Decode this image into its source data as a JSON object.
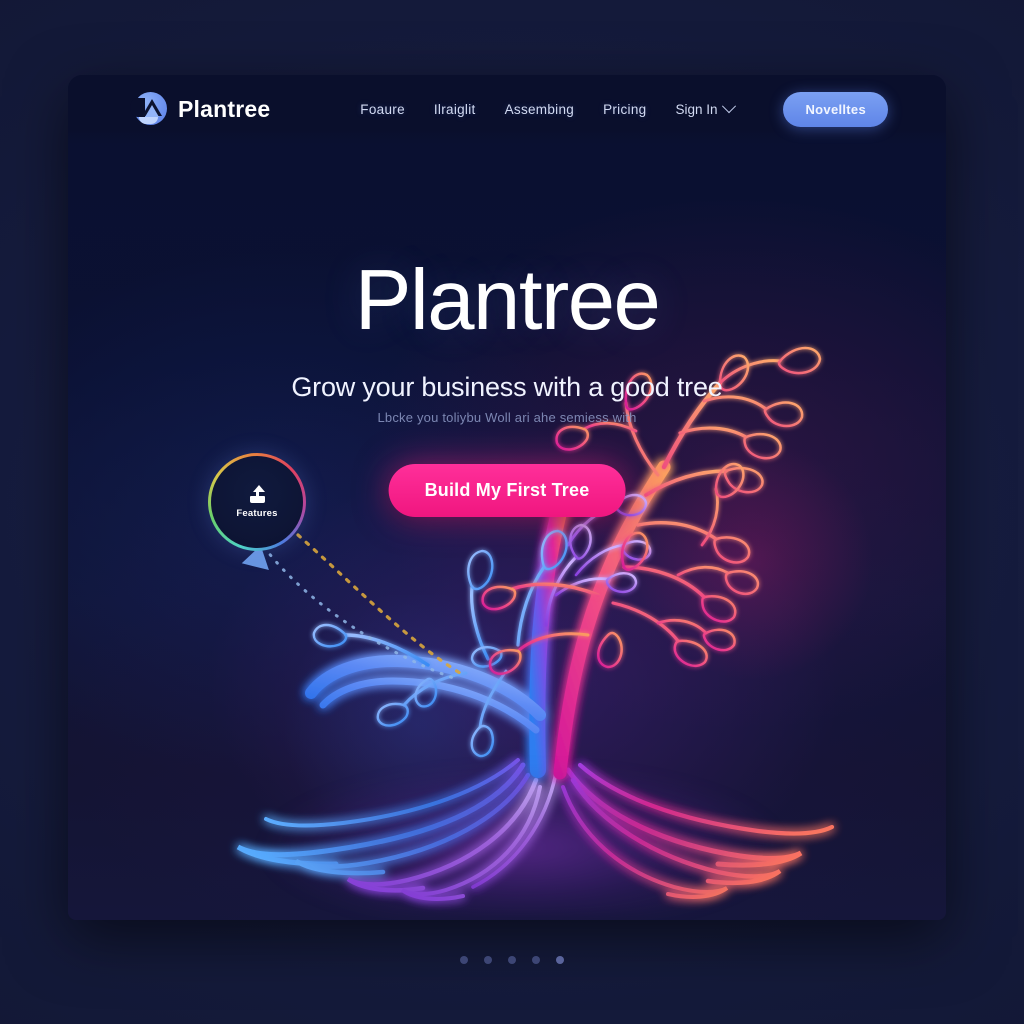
{
  "brand": {
    "name": "Plantree",
    "logo_icon": "plantree-leaf-logo"
  },
  "nav": {
    "links": [
      {
        "label": "Foaure",
        "name": "feature"
      },
      {
        "label": "Ilraiglit",
        "name": "insight"
      },
      {
        "label": "Assembing",
        "name": "assembling"
      },
      {
        "label": "Pricing",
        "name": "pricing"
      }
    ],
    "signin": {
      "label": "Sign In",
      "chevron": "chevron-down-icon"
    },
    "cta": {
      "label": "Novelltes"
    }
  },
  "hero": {
    "title": "Plantree",
    "subtitle": "Grow your business with a good tree",
    "tagline": "Lbcke you toliybu Woll ari ahe semiess with",
    "cta_label": "Build My First Tree"
  },
  "badge": {
    "label": "Features",
    "icon": "upload-icon"
  },
  "carousel": {
    "dots": 5,
    "active_index": 4
  },
  "colors": {
    "page_background": "#161c3d",
    "card_background": "#0d1330",
    "nav_background": "#0a0f2c",
    "accent_pink": "#ff2f9a",
    "accent_blue": "#6e93ef",
    "text_primary": "#ffffff",
    "text_muted": "#8e9ac6",
    "tree_blue": "#3b8ef5",
    "tree_magenta": "#e81e82",
    "tree_orange": "#f98a52",
    "tree_purple": "#9b4de0"
  },
  "illustration": {
    "name": "neon-tree",
    "description": "glowing neon line-art tree with leaves and spreading roots"
  }
}
